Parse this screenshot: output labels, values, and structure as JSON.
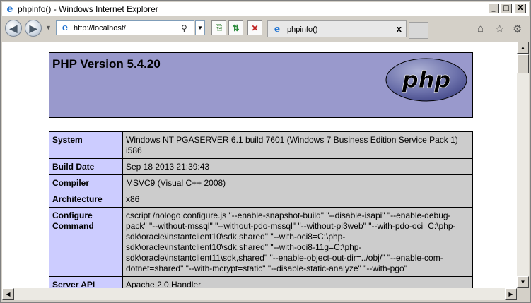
{
  "window": {
    "title": "phpinfo() - Windows Internet Explorer",
    "buttons": {
      "minimize": "_",
      "maximize": "□",
      "close": "X"
    }
  },
  "toolbar": {
    "address": "http://localhost/",
    "tab_label": "phpinfo()",
    "tab_close": "x"
  },
  "page": {
    "title": "PHP Version 5.4.20",
    "logo_text": "php",
    "rows": [
      {
        "key": "System",
        "value": "Windows NT PGASERVER 6.1 build 7601 (Windows 7 Business Edition Service Pack 1) i586"
      },
      {
        "key": "Build Date",
        "value": "Sep 18 2013 21:39:43"
      },
      {
        "key": "Compiler",
        "value": "MSVC9 (Visual C++ 2008)"
      },
      {
        "key": "Architecture",
        "value": "x86"
      },
      {
        "key": "Configure Command",
        "value": "cscript /nologo configure.js \"--enable-snapshot-build\" \"--disable-isapi\" \"--enable-debug-pack\" \"--without-mssql\" \"--without-pdo-mssql\" \"--without-pi3web\" \"--with-pdo-oci=C:\\php-sdk\\oracle\\instantclient10\\sdk,shared\" \"--with-oci8=C:\\php-sdk\\oracle\\instantclient10\\sdk,shared\" \"--with-oci8-11g=C:\\php-sdk\\oracle\\instantclient11\\sdk,shared\" \"--enable-object-out-dir=../obj/\" \"--enable-com-dotnet=shared\" \"--with-mcrypt=static\" \"--disable-static-analyze\" \"--with-pgo\""
      },
      {
        "key": "Server API",
        "value": "Apache 2.0 Handler"
      }
    ]
  },
  "colors": {
    "header_bg": "#9999cc",
    "key_bg": "#ccccff",
    "value_bg": "#cccccc"
  }
}
